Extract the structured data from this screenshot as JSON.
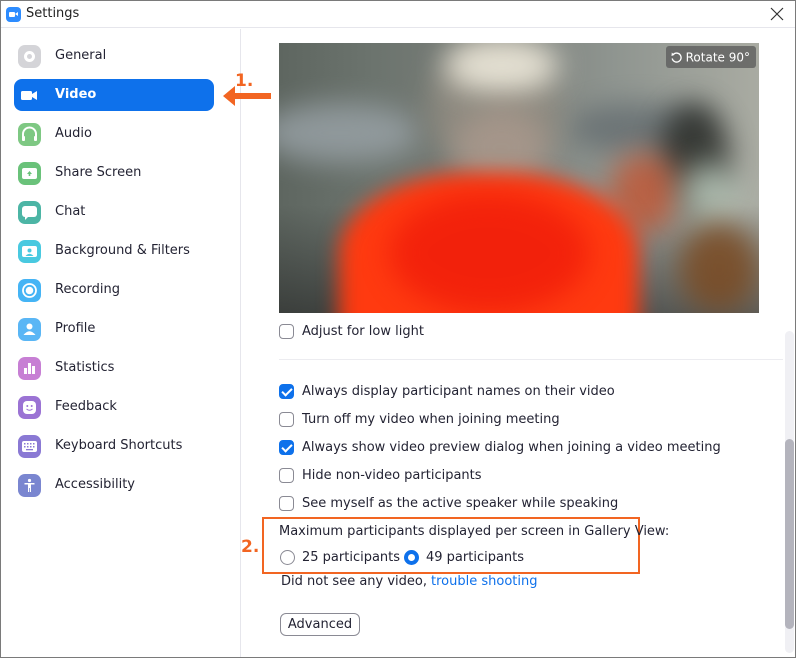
{
  "window": {
    "title": "Settings",
    "close_icon": "close-icon"
  },
  "sidebar": {
    "items": [
      {
        "id": "general",
        "label": "General",
        "icon": "gear-icon",
        "color": "#d4d4d8",
        "active": false
      },
      {
        "id": "video",
        "label": "Video",
        "icon": "video-camera-icon",
        "color": "#0e71eb",
        "active": true
      },
      {
        "id": "audio",
        "label": "Audio",
        "icon": "headphones-icon",
        "color": "#7ec883",
        "active": false
      },
      {
        "id": "share-screen",
        "label": "Share Screen",
        "icon": "share-screen-icon",
        "color": "#6ac27a",
        "active": false
      },
      {
        "id": "chat",
        "label": "Chat",
        "icon": "chat-bubble-icon",
        "color": "#4cb5a5",
        "active": false
      },
      {
        "id": "background-filters",
        "label": "Background & Filters",
        "icon": "background-person-icon",
        "color": "#49c9e0",
        "active": false
      },
      {
        "id": "recording",
        "label": "Recording",
        "icon": "record-icon",
        "color": "#45b4f5",
        "active": false
      },
      {
        "id": "profile",
        "label": "Profile",
        "icon": "person-icon",
        "color": "#5ab6f5",
        "active": false
      },
      {
        "id": "statistics",
        "label": "Statistics",
        "icon": "bar-chart-icon",
        "color": "#c77fd4",
        "active": false
      },
      {
        "id": "feedback",
        "label": "Feedback",
        "icon": "smiley-icon",
        "color": "#9b73d4",
        "active": false
      },
      {
        "id": "keyboard-shortcuts",
        "label": "Keyboard Shortcuts",
        "icon": "keyboard-icon",
        "color": "#8a79d4",
        "active": false
      },
      {
        "id": "accessibility",
        "label": "Accessibility",
        "icon": "accessibility-icon",
        "color": "#7a86d0",
        "active": false
      }
    ]
  },
  "annotations": {
    "step1": "1.",
    "step2": "2.",
    "color": "#f26522"
  },
  "video": {
    "rotate_label": "Rotate 90°"
  },
  "options": {
    "adjust_low_light": {
      "label": "Adjust for low light",
      "checked": false
    },
    "checkboxes": [
      {
        "label": "Always display participant names on their video",
        "checked": true
      },
      {
        "label": "Turn off my video when joining meeting",
        "checked": false
      },
      {
        "label": "Always show video preview dialog when joining a video meeting",
        "checked": true
      },
      {
        "label": "Hide non-video participants",
        "checked": false
      },
      {
        "label": "See myself as the active speaker while speaking",
        "checked": false
      }
    ]
  },
  "gallery": {
    "label": "Maximum participants displayed per screen in Gallery View:",
    "options": [
      {
        "label": "25 participants",
        "selected": false
      },
      {
        "label": "49 participants",
        "selected": true
      }
    ]
  },
  "troubleshoot": {
    "text": "Did not see any video,",
    "link": "trouble shooting"
  },
  "advanced_button": "Advanced",
  "colors": {
    "accent": "#0e71eb",
    "annotation": "#f26522"
  }
}
